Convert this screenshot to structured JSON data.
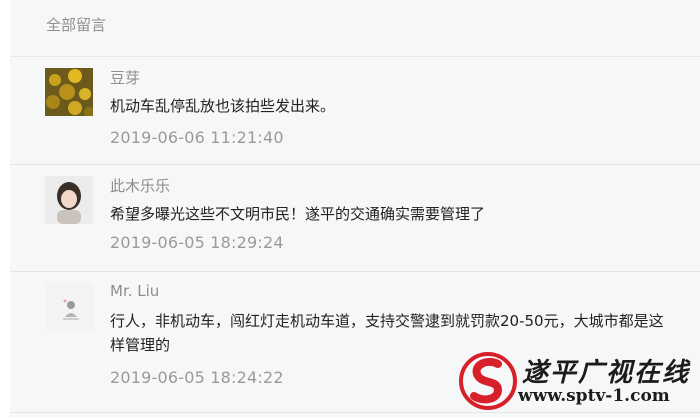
{
  "section_title": "全部留言",
  "comments": [
    {
      "author": "豆芽",
      "text": "机动车乱停乱放也该拍些发出来。",
      "time": "2019-06-06 11:21:40"
    },
    {
      "author": "此木乐乐",
      "text": "希望多曝光这些不文明市民！遂平的交通确实需要管理了",
      "time": "2019-06-05 18:29:24"
    },
    {
      "author": "Mr. Liu",
      "text": "行人，非机动车，闯红灯走机动车道，支持交警逮到就罚款20-50元，大城市都是这样管理的",
      "time": "2019-06-05 18:24:22"
    }
  ],
  "watermark": {
    "title": "遂平广视在线",
    "url": "www.sptv-1.com",
    "colors": {
      "logo_red": "#d6202a",
      "text": "#1c1c1c"
    }
  },
  "colors": {
    "background": "#f6f7f8",
    "divider": "#e5e5e5",
    "meta_text": "#9a9a9a",
    "body_text": "#222222"
  }
}
